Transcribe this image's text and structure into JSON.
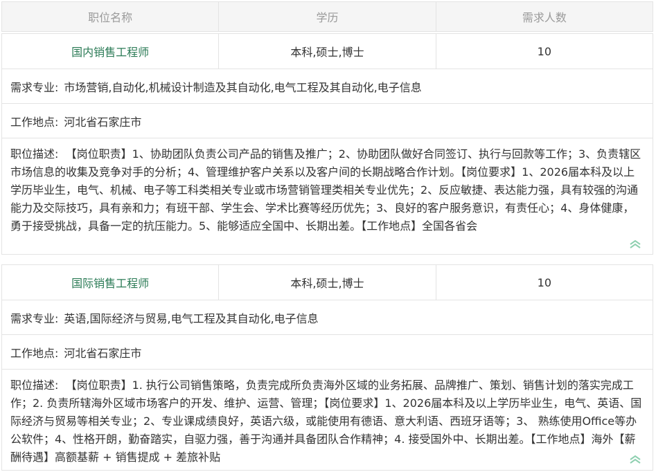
{
  "header": {
    "col_position": "职位名称",
    "col_education": "学历",
    "col_headcount": "需求人数"
  },
  "jobs": [
    {
      "title": "国内销售工程师",
      "education": "本科,硕士,博士",
      "headcount": "10",
      "major_label": "需求专业:",
      "major": "市场营销,自动化,机械设计制造及其自动化,电气工程及其自动化,电子信息",
      "location_label": "工作地点:",
      "location": "河北省石家庄市",
      "desc_label": "职位描述:",
      "desc": "【岗位职责】1、协助团队负责公司产品的销售及推广；2、协助团队做好合同签订、执行与回款等工作；3、负责辖区市场信息的收集及竞争对手的分析；4、管理维护客户关系以及客户间的长期战略合作计划。【岗位要求】1、2026届本科及以上学历毕业生，电气、机械、电子等工科类相关专业或市场营销管理类相关专业优先；2、反应敏捷、表达能力强，具有较强的沟通能力及交际技巧，具有亲和力；有班干部、学生会、学术比赛等经历优先；3、良好的客户服务意识，有责任心；4、身体健康，勇于接受挑战，具备一定的抗压能力。5、能够适应全国中、长期出差。【工作地点】全国各省会",
      "collapse_icon": "chevron-double-up-icon"
    },
    {
      "title": "国际销售工程师",
      "education": "本科,硕士,博士",
      "headcount": "10",
      "major_label": "需求专业:",
      "major": "英语,国际经济与贸易,电气工程及其自动化,电子信息",
      "location_label": "工作地点:",
      "location": "河北省石家庄市",
      "desc_label": "职位描述:",
      "desc": "【岗位职责】1. 执行公司销售策略，负责完成所负责海外区域的业务拓展、品牌推广、策划、销售计划的落实完成工作；2. 负责所辖海外区域市场客户的开发、维护、运营、管理；【岗位要求】1、2026届本科及以上学历毕业生，电气、英语、国际经济与贸易等相关专业；2、专业课成绩良好，英语六级，或能使用有德语、意大利语、西班牙语等；3、 熟练使用Office等办公软件；4、性格开朗，勤奋踏实，自驱力强，善于沟通并具备团队合作精神；4. 接受国外中、长期出差。【工作地点】海外【薪酬待遇】高额基薪 + 销售提成 + 差旅补贴",
      "collapse_icon": "chevron-double-up-icon"
    }
  ],
  "colors": {
    "accent": "#2a7a55",
    "border": "#e3e3e3",
    "header_bg": "#f5f5f5",
    "chevron": "#8fd0b0"
  }
}
